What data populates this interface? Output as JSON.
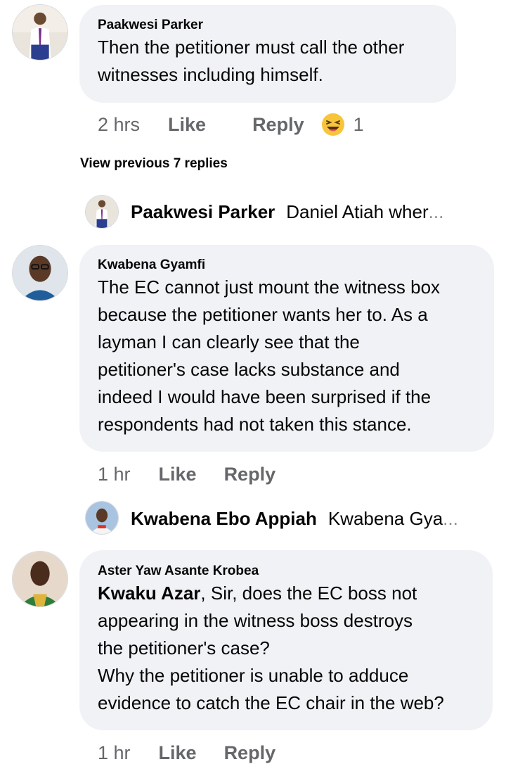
{
  "comments": [
    {
      "author": "Paakwesi Parker",
      "text": "Then the petitioner must call the other witnesses including himself.",
      "lines": [
        "Then the petitioner must call the other",
        "witnesses including himself."
      ],
      "time": "2 hrs",
      "like": "Like",
      "reply": "Reply",
      "reaction_icon": "laughing-emoji",
      "reaction_count": "1"
    },
    {
      "author": "Kwabena Gyamfi",
      "lines": [
        "The EC cannot just mount the witness box",
        "because the petitioner wants her to. As a",
        "layman I can clearly see that the",
        "petitioner's case lacks substance and",
        "indeed I would have been surprised if the",
        "respondents had not taken this stance."
      ],
      "time": "1 hr",
      "like": "Like",
      "reply": "Reply"
    },
    {
      "author": "Aster Yaw Asante Krobea",
      "mention": "Kwaku Azar",
      "first_line_rest": ", Sir, does the EC boss not",
      "lines": [
        "appearing in the witness boss destroys",
        "the petitioner's case?",
        "Why the petitioner is unable to adduce",
        "evidence to catch the EC chair in the web?"
      ],
      "time": "1 hr",
      "like": "Like",
      "reply": "Reply"
    }
  ],
  "view_previous": "View previous 7 replies",
  "reply_previews": [
    {
      "name": "Paakwesi Parker",
      "snippet": "Daniel Atiah  wher",
      "ellipsis": "..."
    },
    {
      "name": "Kwabena Ebo Appiah",
      "snippet": "Kwabena Gya",
      "ellipsis": "..."
    }
  ],
  "colors": {
    "bubble": "#f0f2f5",
    "secondary_text": "#65676b",
    "primary_text": "#050505"
  }
}
